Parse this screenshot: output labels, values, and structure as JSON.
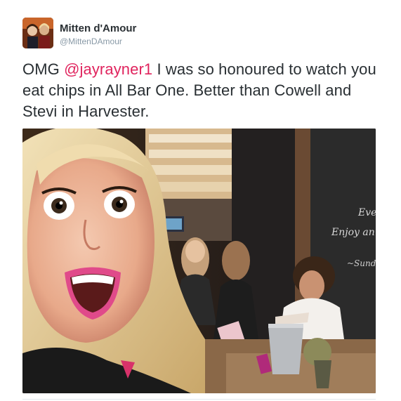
{
  "tweet": {
    "author": {
      "display_name": "Mitten d'Amour",
      "handle": "@MittenDAmour",
      "avatar_icon": "profile-avatar"
    },
    "text": {
      "prefix": "OMG ",
      "mention": "@jayrayner1",
      "suffix": " I was so honoured to watch you eat chips in All Bar One. Better than Cowell and Stevi in Harvester."
    },
    "photo": {
      "description_icon": "selfie-photo",
      "chalkboard_text": [
        "Eve",
        "Enjoy an",
        "~Sund"
      ]
    },
    "colors": {
      "text": "#292f33",
      "mention": "#e0245e",
      "handle": "#8899a6"
    }
  }
}
